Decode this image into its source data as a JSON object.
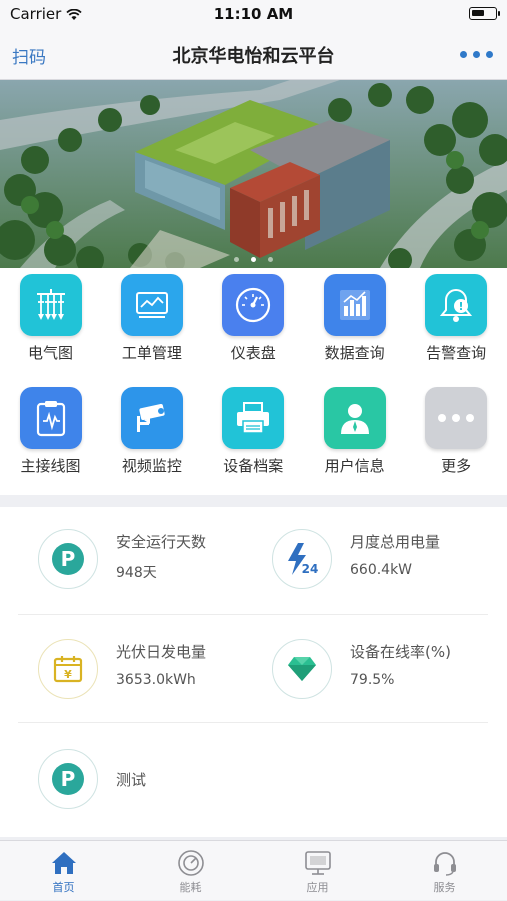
{
  "status_bar": {
    "carrier": "Carrier",
    "time": "11:10 AM"
  },
  "navbar": {
    "scan_label": "扫码",
    "title": "北京华电怡和云平台"
  },
  "banner": {
    "page_count": 3,
    "active_index": 1
  },
  "grid": [
    {
      "label": "电气图",
      "icon": "electrical-diagram-icon",
      "color": "#21c3d7"
    },
    {
      "label": "工单管理",
      "icon": "work-order-icon",
      "color": "#2ba6ec"
    },
    {
      "label": "仪表盘",
      "icon": "gauge-icon",
      "color": "#4a80ee"
    },
    {
      "label": "数据查询",
      "icon": "data-chart-icon",
      "color": "#3f84ea"
    },
    {
      "label": "告警查询",
      "icon": "alarm-bell-icon",
      "color": "#21c3d7"
    },
    {
      "label": "主接线图",
      "icon": "clipboard-icon",
      "color": "#3f84ea"
    },
    {
      "label": "视频监控",
      "icon": "camera-icon",
      "color": "#2d95ea"
    },
    {
      "label": "设备档案",
      "icon": "printer-icon",
      "color": "#21c3d7"
    },
    {
      "label": "用户信息",
      "icon": "user-icon",
      "color": "#29c7a4"
    },
    {
      "label": "更多",
      "icon": "more-icon",
      "color": "#cfd1d6"
    }
  ],
  "stats": [
    {
      "title": "安全运行天数",
      "value": "948天",
      "icon": "parking-p-icon"
    },
    {
      "title": "月度总用电量",
      "value": "660.4kW",
      "icon": "lightning-24-icon"
    },
    {
      "title": "光伏日发电量",
      "value": "3653.0kWh",
      "icon": "calendar-yen-icon"
    },
    {
      "title": "设备在线率(%)",
      "value": "79.5%",
      "icon": "diamond-icon"
    },
    {
      "title": "测试",
      "value": "",
      "icon": "parking-p-icon"
    }
  ],
  "tabs": [
    {
      "label": "首页",
      "icon": "home-icon",
      "active": true
    },
    {
      "label": "能耗",
      "icon": "energy-icon",
      "active": false
    },
    {
      "label": "应用",
      "icon": "app-icon",
      "active": false
    },
    {
      "label": "服务",
      "icon": "headset-icon",
      "active": false
    }
  ],
  "colors": {
    "accent": "#2f6fc0",
    "teal": "#2aa79b"
  }
}
